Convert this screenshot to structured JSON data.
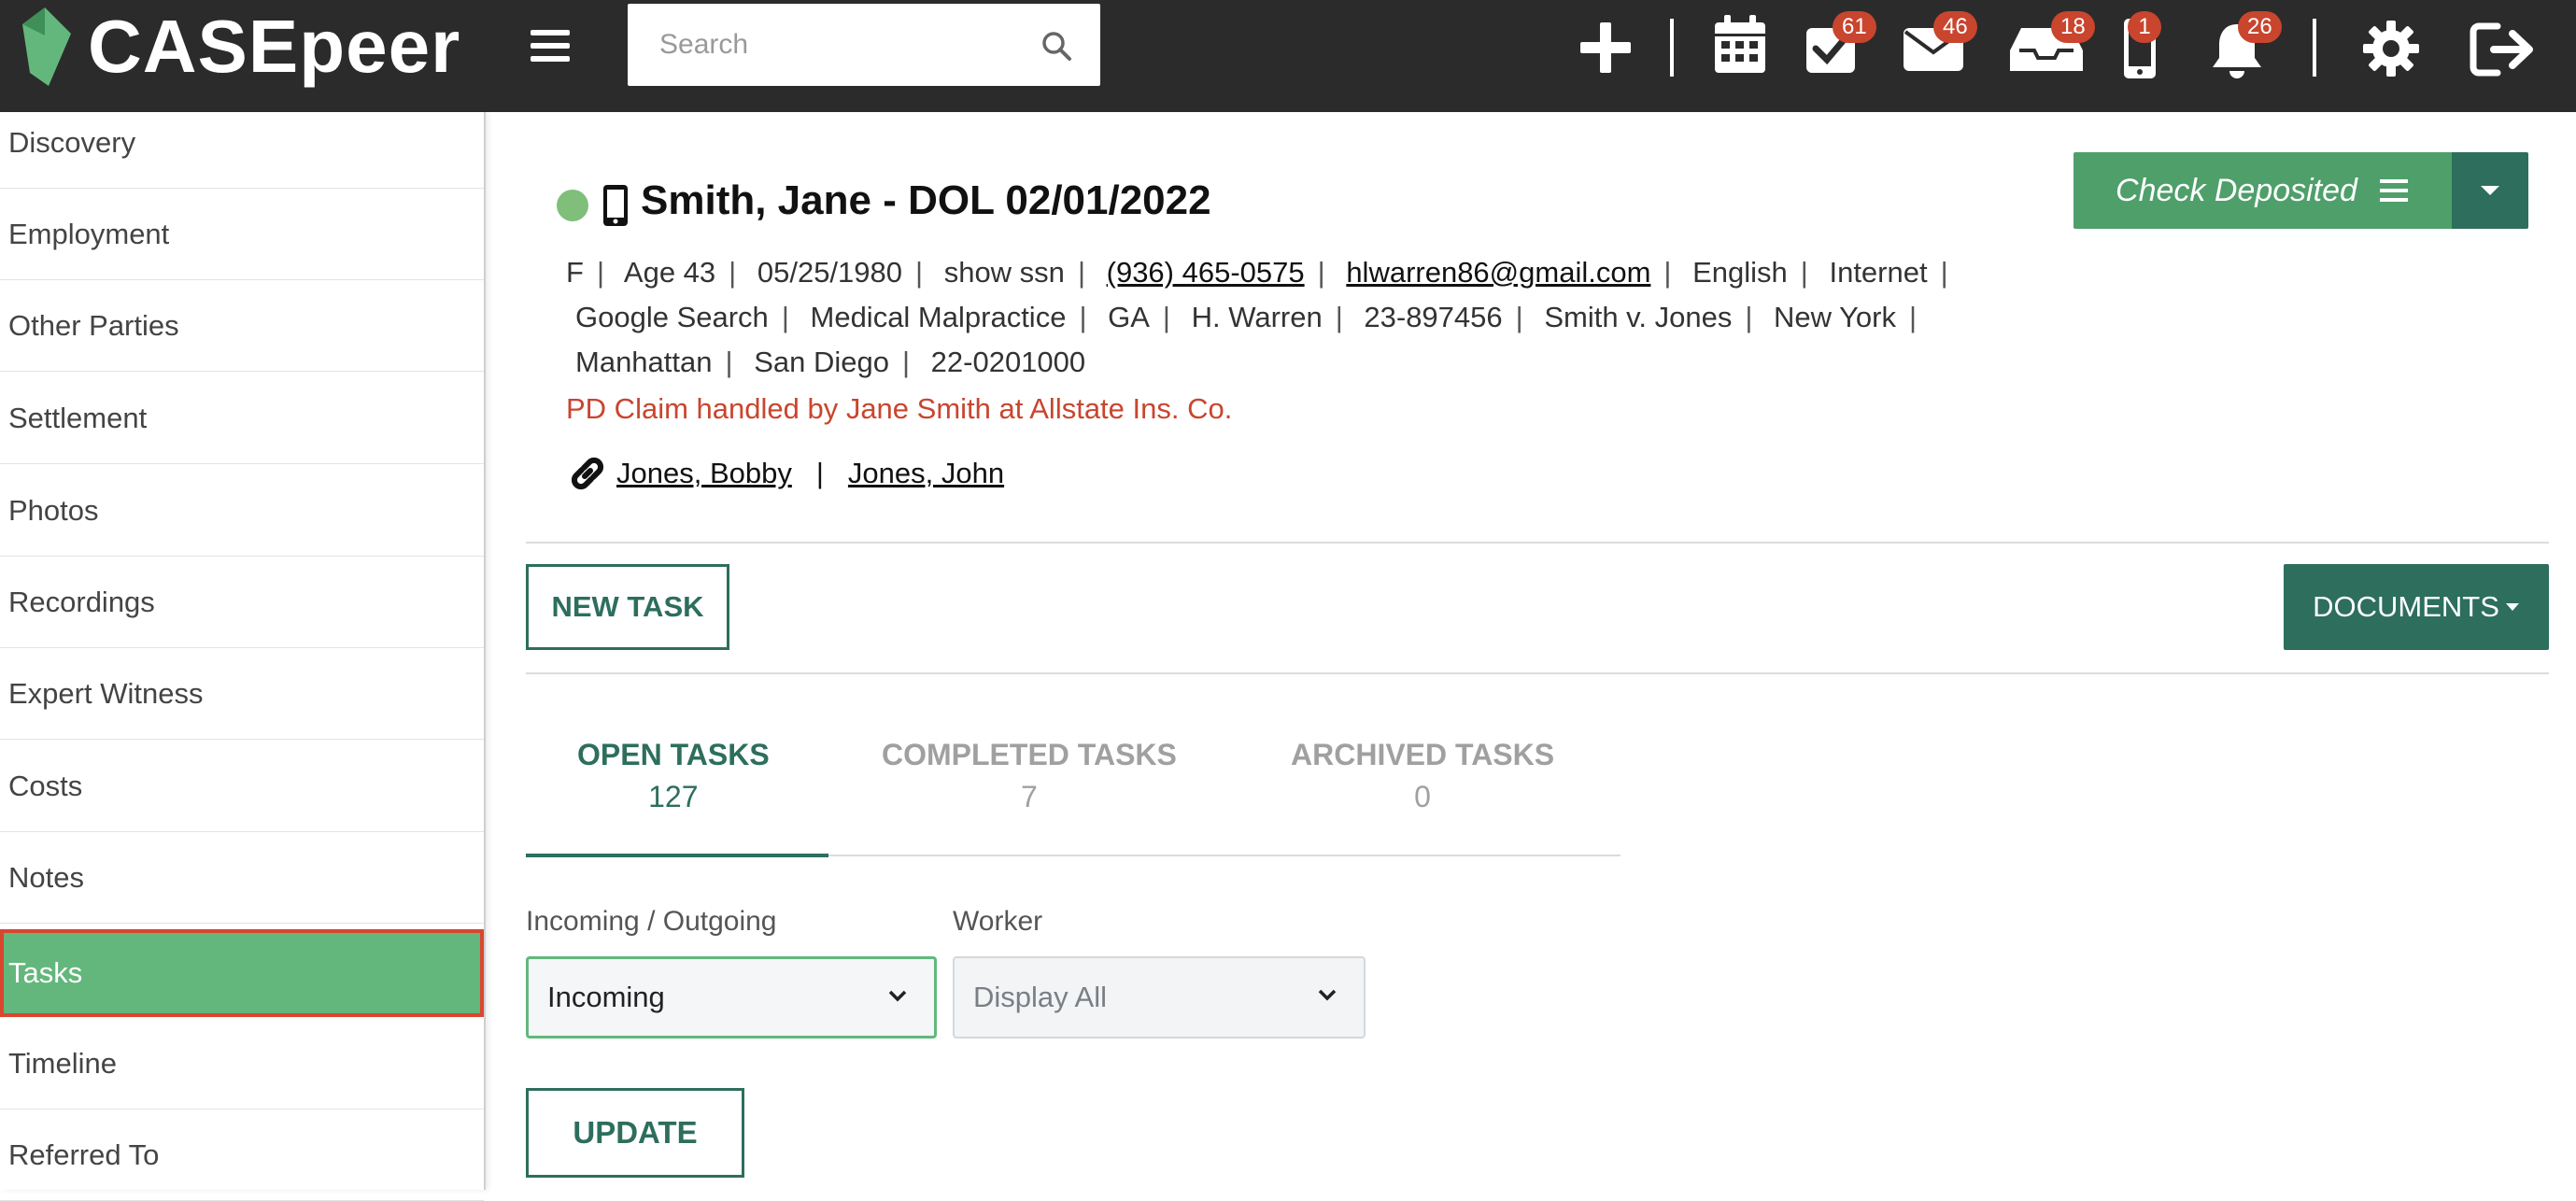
{
  "app": {
    "name": "CASEpeer"
  },
  "search": {
    "placeholder": "Search"
  },
  "topbar": {
    "badges": {
      "tasks": "61",
      "mail": "46",
      "inbox": "18",
      "phone": "1",
      "notifications": "26"
    }
  },
  "colors": {
    "topbar": "#2b2b2b",
    "accent_green": "#63b77c",
    "dark_teal": "#2d6e5d",
    "badge_red": "#c9452e",
    "active_border": "#d9462e"
  },
  "sidebar": {
    "items": [
      {
        "label": "Discovery"
      },
      {
        "label": "Employment"
      },
      {
        "label": "Other Parties"
      },
      {
        "label": "Settlement"
      },
      {
        "label": "Photos"
      },
      {
        "label": "Recordings"
      },
      {
        "label": "Expert Witness"
      },
      {
        "label": "Costs"
      },
      {
        "label": "Notes"
      },
      {
        "label": "Tasks",
        "active": true
      },
      {
        "label": "Timeline"
      },
      {
        "label": "Referred To"
      }
    ]
  },
  "case": {
    "title": "Smith, Jane - DOL 02/01/2022",
    "sex": "F",
    "age": "Age 43",
    "dob": "05/25/1980",
    "ssn": "show ssn",
    "phone": "(936) 465-0575",
    "email": "hlwarren86@gmail.com",
    "language": "English",
    "source": "Internet",
    "referral": "Google Search",
    "case_type": "Medical Malpractice",
    "state": "GA",
    "attorney": "H. Warren",
    "case_number": "23-897456",
    "case_name": "Smith v. Jones",
    "city1": "New York",
    "city2": "Manhattan",
    "city3": "San Diego",
    "code": "22-0201000",
    "claim_note": "PD Claim handled by Jane Smith at Allstate Ins. Co.",
    "related": [
      "Jones, Bobby",
      "Jones, John"
    ],
    "status_button": "Check Deposited"
  },
  "actions": {
    "new_task": "NEW TASK",
    "documents": "DOCUMENTS"
  },
  "tabs": [
    {
      "label": "OPEN TASKS",
      "count": "127"
    },
    {
      "label": "COMPLETED TASKS",
      "count": "7"
    },
    {
      "label": "ARCHIVED TASKS",
      "count": "0"
    }
  ],
  "filters": {
    "direction": {
      "label": "Incoming / Outgoing",
      "value": "Incoming"
    },
    "worker": {
      "label": "Worker",
      "value": "Display All"
    },
    "update": "UPDATE"
  }
}
